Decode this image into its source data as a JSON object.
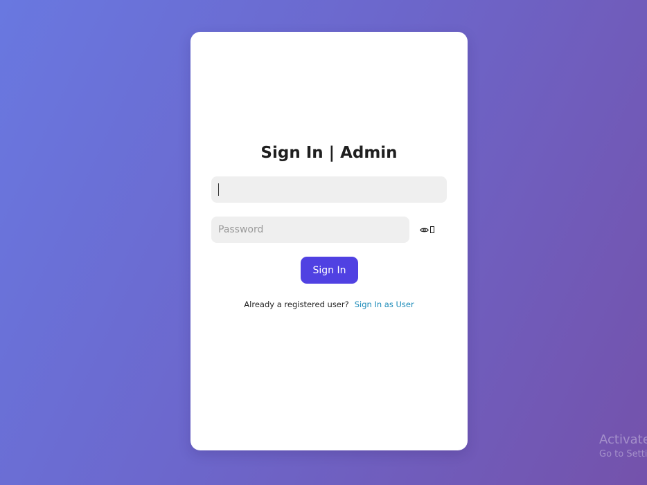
{
  "login": {
    "title": "Sign In | Admin",
    "username_value": "",
    "password_placeholder": "Password",
    "password_toggle_icon": "eye-icon",
    "submit_label": "Sign In",
    "footer_text": "Already a registered user?",
    "footer_link": "Sign In as User"
  },
  "watermark": {
    "title": "Activate",
    "subtitle": "Go to Setti"
  },
  "colors": {
    "background_start": "#6978e0",
    "background_end": "#7452ab",
    "primary_button": "#5041e2",
    "link": "#1a8ab8",
    "input_background": "#efefef"
  }
}
